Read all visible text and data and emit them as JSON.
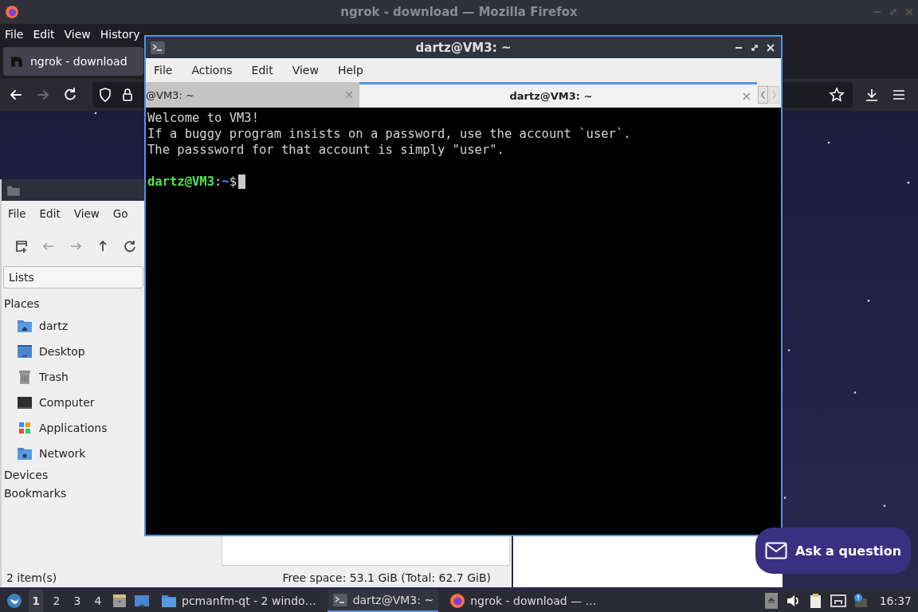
{
  "firefox": {
    "title": "ngrok - download — Mozilla Firefox",
    "menu": [
      "File",
      "Edit",
      "View",
      "History"
    ],
    "tabs": [
      {
        "label": "ngrok - download",
        "selected": true
      }
    ],
    "nav": [
      {
        "kind": "back",
        "disabled": false
      },
      {
        "kind": "forward",
        "disabled": true
      },
      {
        "kind": "reload",
        "disabled": false
      }
    ],
    "ask_button": "Ask a question"
  },
  "file_manager": {
    "menu": [
      "File",
      "Edit",
      "View",
      "Go"
    ],
    "toolbar": [
      {
        "kind": "new-tab",
        "disabled": false
      },
      {
        "kind": "back",
        "disabled": true
      },
      {
        "kind": "forward",
        "disabled": true
      },
      {
        "kind": "up",
        "disabled": false
      },
      {
        "kind": "reload",
        "disabled": false
      }
    ],
    "view_selector": "Lists",
    "sections": [
      {
        "label": "Places",
        "items": [
          {
            "kind": "home",
            "label": "dartz"
          },
          {
            "kind": "desktop",
            "label": "Desktop"
          },
          {
            "kind": "trash",
            "label": "Trash"
          },
          {
            "kind": "computer",
            "label": "Computer"
          },
          {
            "kind": "apps",
            "label": "Applications"
          },
          {
            "kind": "network",
            "label": "Network"
          }
        ]
      },
      {
        "label": "Devices"
      },
      {
        "label": "Bookmarks"
      }
    ],
    "status_items": "2 item(s)",
    "status_space": "Free space: 53.1 GiB (Total: 62.7 GiB)"
  },
  "terminal": {
    "title": "dartz@VM3: ~",
    "menu": [
      "File",
      "Actions",
      "Edit",
      "View",
      "Help"
    ],
    "tabs": [
      {
        "label": "@VM3: ~",
        "selected": false
      },
      {
        "label": "dartz@VM3: ~",
        "selected": true
      }
    ],
    "lines": [
      "Welcome to VM3!",
      "If a buggy program insists on a password, use the account `user`.",
      "The passsword for that account is simply \"user\"."
    ],
    "prompt": {
      "user_host": "dartz@VM3",
      "separator": ":",
      "path": "~",
      "symbol": "$"
    }
  },
  "taskbar": {
    "desktops": [
      {
        "label": "1",
        "selected": true
      },
      {
        "label": "2",
        "selected": false
      },
      {
        "label": "3",
        "selected": false
      },
      {
        "label": "4",
        "selected": false
      }
    ],
    "tasks": [
      {
        "kind": "folder",
        "label": "pcmanfm-qt - 2 windo…",
        "selected": false
      },
      {
        "kind": "terminal",
        "label": "dartz@VM3: ~",
        "selected": true
      },
      {
        "kind": "firefox",
        "label": "ngrok - download — …",
        "selected": false
      }
    ],
    "clock": "16:37"
  }
}
